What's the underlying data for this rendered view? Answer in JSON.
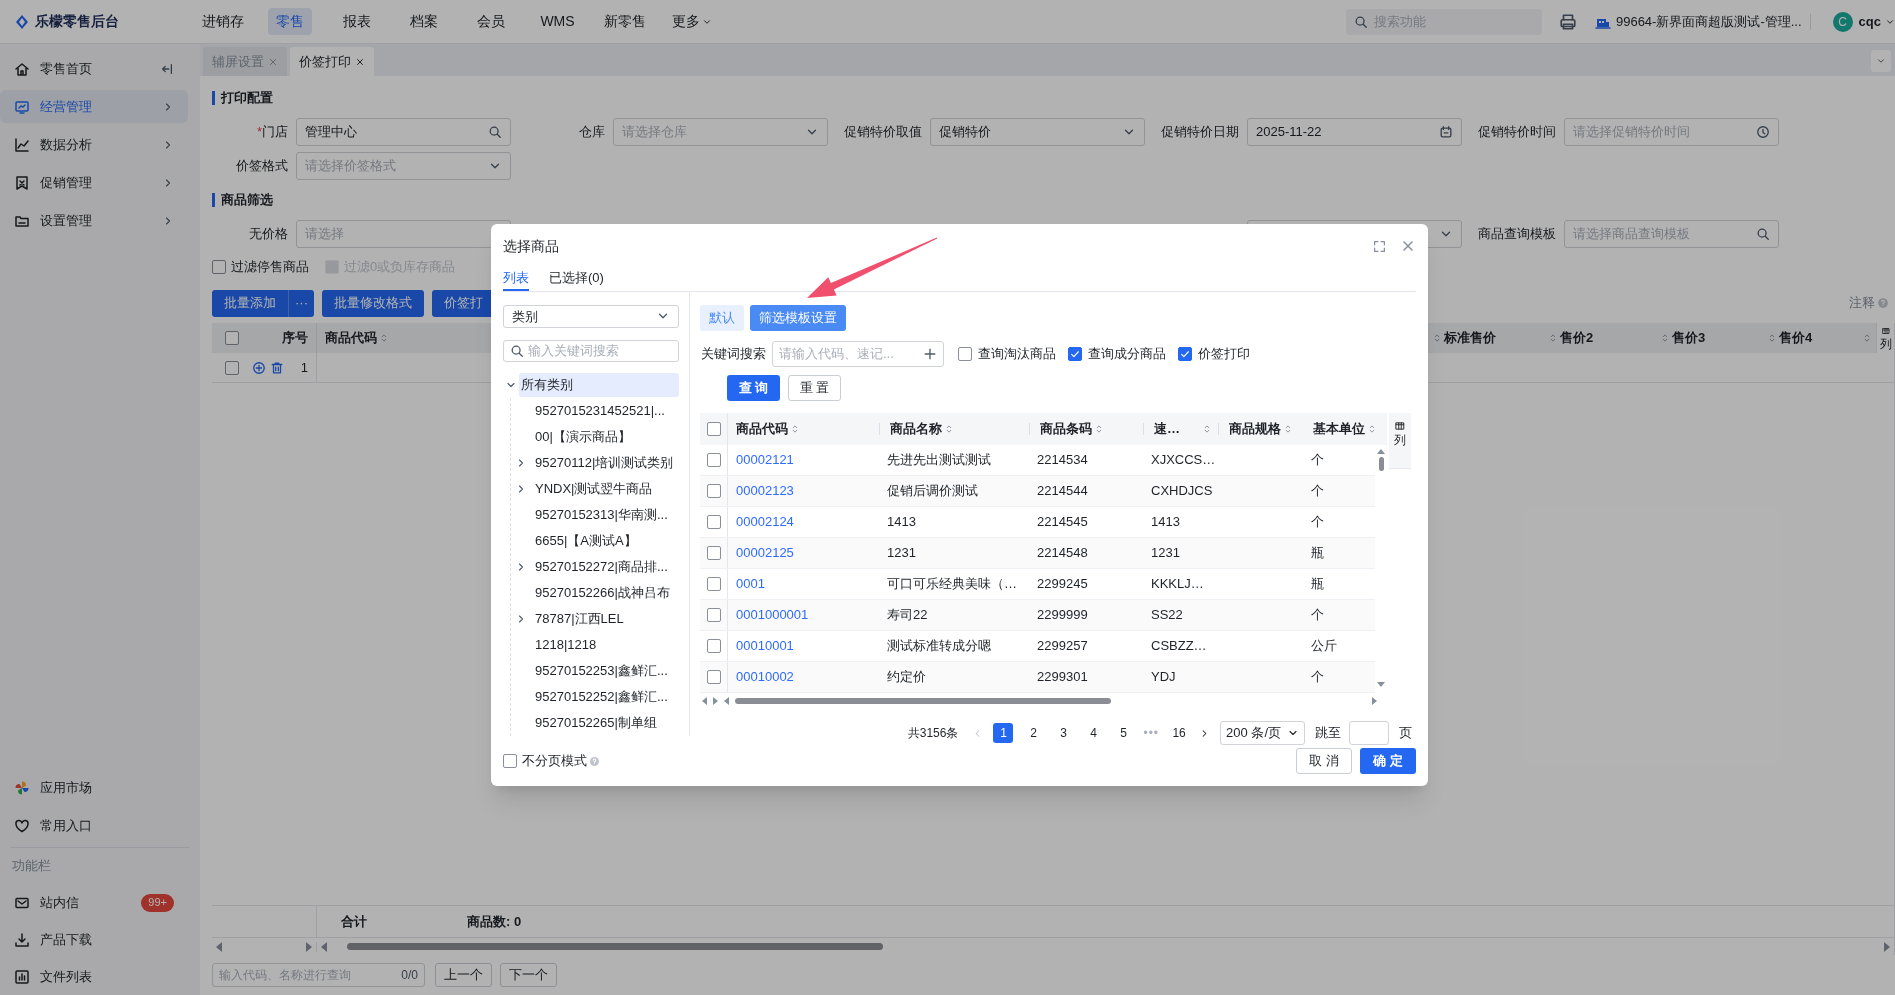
{
  "brand": {
    "name": "乐檬零售后台"
  },
  "top_nav": [
    {
      "label": "进销存",
      "selected": false
    },
    {
      "label": "零售",
      "selected": true
    },
    {
      "label": "报表",
      "selected": false
    },
    {
      "label": "档案",
      "selected": false
    },
    {
      "label": "会员",
      "selected": false
    },
    {
      "label": "WMS",
      "selected": false
    },
    {
      "label": "新零售",
      "selected": false
    },
    {
      "label": "更多",
      "selected": false,
      "dropdown": true
    }
  ],
  "header": {
    "search_placeholder": "搜索功能",
    "store": "99664-新界面商超版测试-管理...",
    "avatar": "C",
    "user": "cqc"
  },
  "sidebar": {
    "items": [
      {
        "label": "零售首页",
        "selected": false,
        "expandable": false
      },
      {
        "label": "经营管理",
        "selected": true,
        "expandable": true
      },
      {
        "label": "数据分析",
        "selected": false,
        "expandable": true
      },
      {
        "label": "促销管理",
        "selected": false,
        "expandable": true
      },
      {
        "label": "设置管理",
        "selected": false,
        "expandable": true
      }
    ],
    "bottom_items": [
      {
        "label": "应用市场"
      },
      {
        "label": "常用入口"
      }
    ],
    "section_title": "功能栏",
    "tools": [
      {
        "label": "站内信",
        "badge": "99+"
      },
      {
        "label": "产品下载"
      },
      {
        "label": "文件列表"
      }
    ]
  },
  "tabs": [
    {
      "label": "辅屏设置",
      "selected": false
    },
    {
      "label": "价签打印",
      "selected": true
    }
  ],
  "print_config": {
    "title": "打印配置",
    "fields": [
      {
        "label": "门店",
        "required_mark": "*",
        "value": "管理中心",
        "kind": "search"
      },
      {
        "label": "仓库",
        "placeholder": "请选择仓库",
        "kind": "select"
      },
      {
        "label": "促销特价取值",
        "value": "促销特价",
        "kind": "select"
      },
      {
        "label": "促销特价日期",
        "value": "2025-11-22",
        "kind": "date"
      },
      {
        "label": "促销特价时间",
        "placeholder": "请选择促销特价时间",
        "kind": "time"
      },
      {
        "label": "价签格式",
        "placeholder": "请选择价签格式",
        "kind": "select"
      }
    ]
  },
  "filter": {
    "title": "商品筛选",
    "fields": [
      {
        "label": "无价格",
        "placeholder": "请选择",
        "kind": "select"
      },
      {
        "kind": "select"
      },
      {
        "label": "商品查询模板",
        "placeholder": "请选择商品查询模板",
        "kind": "search"
      }
    ],
    "checkboxes": [
      {
        "label": "过滤停售商品",
        "checked": false,
        "disabled": false
      },
      {
        "label": "过滤0或负库存商品",
        "checked": false,
        "disabled": true
      }
    ]
  },
  "toolbar": {
    "buttons": [
      {
        "label": "批量添加",
        "more": "···"
      },
      {
        "label": "批量修改格式"
      },
      {
        "label": "价签打"
      }
    ],
    "note": "注释"
  },
  "price_table": {
    "columns": [
      "序号",
      "商品代码",
      "标准售价",
      "售价2",
      "售价3",
      "售价4"
    ],
    "column_settings": "列",
    "all_checked": false,
    "rows": [
      {
        "index": "1",
        "checked": false
      }
    ],
    "total_label": "合计",
    "count": "商品数: 0"
  },
  "search_bar": {
    "placeholder": "输入代码、名称进行查询",
    "counter": "0/0",
    "prev": "上一个",
    "next": "下一个"
  },
  "dialog": {
    "title": "选择商品",
    "tabs": [
      {
        "label": "列表",
        "selected": true
      },
      {
        "label": "已选择(0)",
        "selected": false
      }
    ],
    "category_select": "类别",
    "category_search_placeholder": "输入关键词搜索",
    "tree": [
      {
        "label": "所有类别",
        "expanded": true,
        "selected": true,
        "children": [
          {
            "label": "9527015231452521|...",
            "expandable": false,
            "selected": false
          },
          {
            "label": "00|【演示商品】",
            "expandable": false,
            "selected": false
          },
          {
            "label": "95270112|培训测试类别",
            "expandable": true,
            "selected": false
          },
          {
            "label": "YNDX|测试翌牛商品",
            "expandable": true,
            "selected": false
          },
          {
            "label": "95270152313|华南测...",
            "expandable": false,
            "selected": false
          },
          {
            "label": "6655|【A测试A】",
            "expandable": false,
            "selected": false
          },
          {
            "label": "95270152272|商品排...",
            "expandable": true,
            "selected": false
          },
          {
            "label": "95270152266|战神吕布",
            "expandable": false,
            "selected": false
          },
          {
            "label": "78787|江西LEL",
            "expandable": true,
            "selected": false
          },
          {
            "label": "1218|1218",
            "expandable": false,
            "selected": false
          },
          {
            "label": "95270152253|鑫鲜汇...",
            "expandable": false,
            "selected": false
          },
          {
            "label": "95270152252|鑫鲜汇...",
            "expandable": false,
            "selected": false
          },
          {
            "label": "95270152265|制单组",
            "expandable": false,
            "selected": false
          }
        ]
      }
    ],
    "no_paging": {
      "label": "不分页模式",
      "checked": false
    },
    "templates": [
      {
        "label": "默认",
        "selected": false
      },
      {
        "label": "筛选模板设置",
        "selected": true
      }
    ],
    "keyword": {
      "label": "关键词搜索",
      "placeholder": "请输入代码、速记..."
    },
    "options": [
      {
        "label": "查询淘汰商品",
        "checked": false
      },
      {
        "label": "查询成分商品",
        "checked": true
      },
      {
        "label": "价签打印",
        "checked": true
      }
    ],
    "query_button": "查 询",
    "reset_button": "重 置",
    "table": {
      "columns": [
        "商品代码",
        "商品名称",
        "商品条码",
        "速…",
        "商品规格",
        "基本单位"
      ],
      "column_settings": "列",
      "all_checked": false,
      "rows": [
        {
          "code": "00002121",
          "name": "先进先出测试测试",
          "barcode": "2214534",
          "mnemonic": "XJXCCS…",
          "unit": "个",
          "checked": false
        },
        {
          "code": "00002123",
          "name": "促销后调价测试",
          "barcode": "2214544",
          "mnemonic": "CXHDJCS",
          "unit": "个",
          "checked": false
        },
        {
          "code": "00002124",
          "name": "1413",
          "barcode": "2214545",
          "mnemonic": "1413",
          "unit": "个",
          "checked": false
        },
        {
          "code": "00002125",
          "name": "1231",
          "barcode": "2214548",
          "mnemonic": "1231",
          "unit": "瓶",
          "checked": false
        },
        {
          "code": "0001",
          "name": "可口可乐经典美味（…",
          "barcode": "2299245",
          "mnemonic": "KKKLJ…",
          "unit": "瓶",
          "checked": false
        },
        {
          "code": "0001000001",
          "name": "寿司22",
          "barcode": "2299999",
          "mnemonic": "SS22",
          "unit": "个",
          "checked": false
        },
        {
          "code": "00010001",
          "name": "测试标准转成分嗯",
          "barcode": "2299257",
          "mnemonic": "CSBZZ…",
          "unit": "公斤",
          "checked": false
        },
        {
          "code": "00010002",
          "name": "约定价",
          "barcode": "2299301",
          "mnemonic": "YDJ",
          "unit": "个",
          "checked": false
        }
      ]
    },
    "pagination": {
      "total": "共3156条",
      "pages": [
        {
          "label": "1",
          "selected": true
        },
        {
          "label": "2",
          "selected": false
        },
        {
          "label": "3",
          "selected": false
        },
        {
          "label": "4",
          "selected": false
        },
        {
          "label": "5",
          "selected": false
        }
      ],
      "ellipsis": "•••",
      "last_page": {
        "label": "16",
        "selected": false
      },
      "page_size": "200 条/页",
      "jump_label": "跳至",
      "page_suffix": "页"
    },
    "cancel": "取 消",
    "confirm": "确 定"
  }
}
